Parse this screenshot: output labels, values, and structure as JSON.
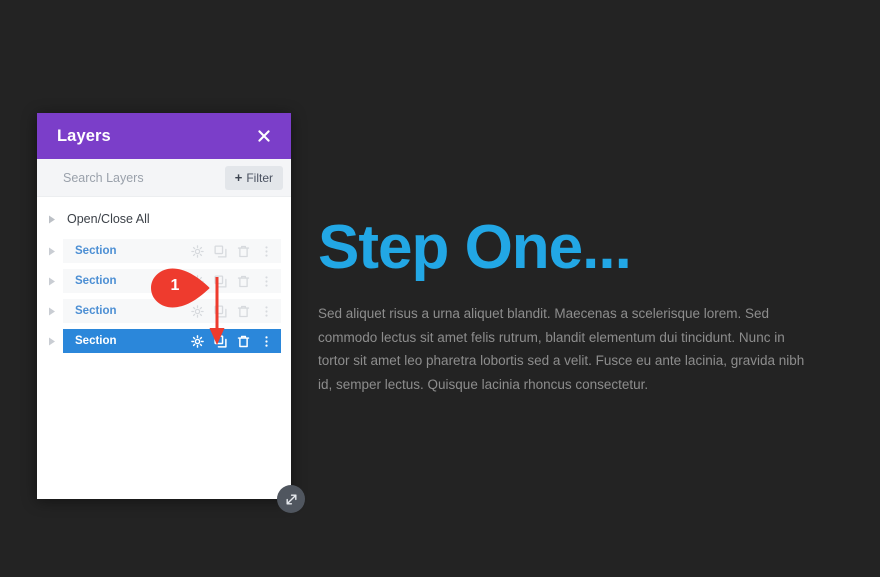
{
  "theme": {
    "page_background": "#232323",
    "panel_header_purple": "#7b3ec9",
    "selected_row_blue": "#2b87da",
    "layer_name_blue": "#4c8fd4",
    "heading_cyan": "#22a7e5",
    "callout_red": "#ee3b2e",
    "body_text_gray": "#8d8d8d"
  },
  "panel": {
    "title": "Layers",
    "close_icon": "close-icon",
    "search": {
      "value": "",
      "placeholder": "Search Layers"
    },
    "filter_button": {
      "plus": "+",
      "label": "Filter",
      "icon": "plus-icon"
    },
    "tree": {
      "open_close_all": "Open/Close All",
      "caret_icon": "caret-right-icon"
    },
    "row_icons": [
      {
        "name": "gear-icon",
        "title": "Settings"
      },
      {
        "name": "duplicate-icon",
        "title": "Duplicate"
      },
      {
        "name": "trash-icon",
        "title": "Delete"
      },
      {
        "name": "more-vertical-icon",
        "title": "More options"
      }
    ],
    "layers": [
      {
        "label": "Section",
        "selected": false
      },
      {
        "label": "Section",
        "selected": false
      },
      {
        "label": "Section",
        "selected": false
      },
      {
        "label": "Section",
        "selected": true
      }
    ],
    "resize_handle_icon": "resize-diagonal-icon"
  },
  "callout": {
    "number": "1",
    "pin_icon": "teardrop-pin-icon",
    "arrow_icon": "arrow-down-icon"
  },
  "content": {
    "heading": "Step One...",
    "body": "Sed aliquet risus a urna aliquet blandit. Maecenas a scelerisque lorem. Sed commodo lectus sit amet felis rutrum, blandit elementum dui tincidunt. Nunc in tortor sit amet leo pharetra lobortis sed a velit. Fusce eu ante lacinia, gravida nibh id, semper lectus. Quisque lacinia rhoncus consectetur."
  }
}
